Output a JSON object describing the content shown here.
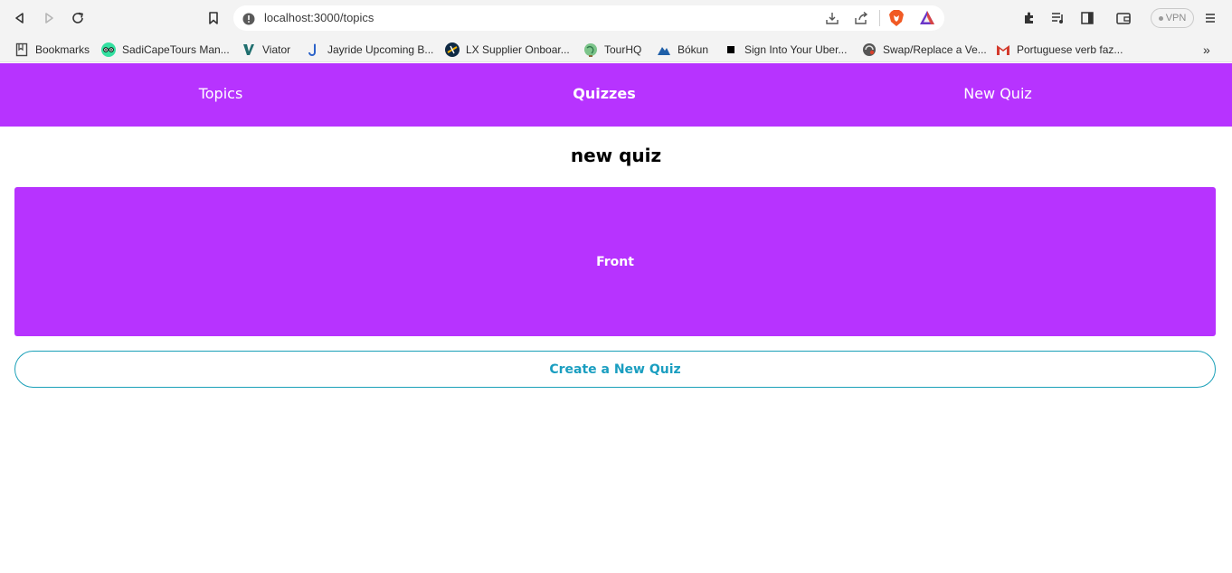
{
  "browser": {
    "url": "localhost:3000/topics",
    "vpn_label": "VPN",
    "bookmarks": [
      {
        "label": "Bookmarks",
        "icon": "bookmarks-folder-icon"
      },
      {
        "label": "SadiCapeTours Man...",
        "icon": "tripadvisor-icon"
      },
      {
        "label": "Viator",
        "icon": "viator-icon"
      },
      {
        "label": "Jayride Upcoming B...",
        "icon": "jayride-icon"
      },
      {
        "label": "LX Supplier Onboar...",
        "icon": "lx-icon"
      },
      {
        "label": "TourHQ",
        "icon": "globe-icon"
      },
      {
        "label": "Bókun",
        "icon": "bokun-icon"
      },
      {
        "label": "Sign Into Your Uber...",
        "icon": "uber-icon"
      },
      {
        "label": "Swap/Replace a Ve...",
        "icon": "swap-icon"
      },
      {
        "label": "Portuguese verb faz...",
        "icon": "gmail-icon"
      }
    ],
    "overflow": "»"
  },
  "nav": {
    "topics": "Topics",
    "quizzes": "Quizzes",
    "new_quiz": "New Quiz"
  },
  "main": {
    "title": "new quiz",
    "card_label": "Front",
    "create_button": "Create a New Quiz"
  },
  "colors": {
    "accent": "#b733ff",
    "button_text": "#1a9ec0"
  }
}
